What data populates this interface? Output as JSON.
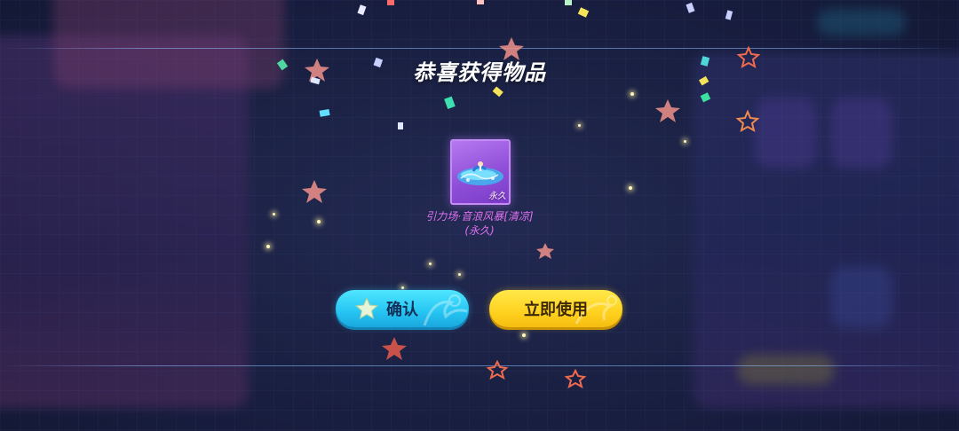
{
  "popup": {
    "title": "恭喜获得物品"
  },
  "reward": {
    "icon": "blue-dolphin-wave-icon",
    "duration_tag": "永久",
    "name": "引力场·音浪风暴[清凉]",
    "duration": "(永久)",
    "rarity_color": "#a862e8"
  },
  "buttons": {
    "confirm_label": "确认",
    "use_label": "立即使用"
  },
  "colors": {
    "confirm_button": "#25c4f2",
    "use_button": "#ffd21f",
    "item_name_text": "#e070f0"
  }
}
